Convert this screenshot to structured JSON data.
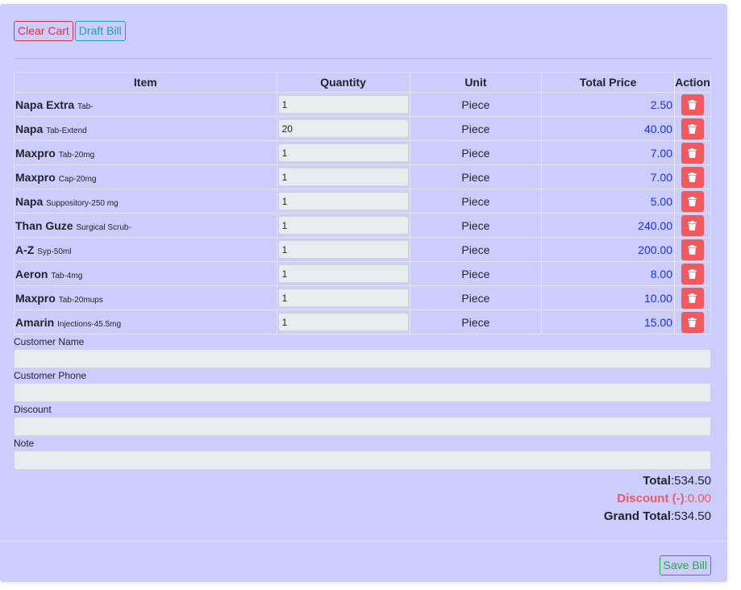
{
  "toolbar": {
    "clear_cart_label": "Clear Cart",
    "draft_bill_label": "Draft Bill"
  },
  "table": {
    "headers": [
      "Item",
      "Quantity",
      "Unit",
      "Total Price",
      "Action"
    ],
    "rows": [
      {
        "name": "Napa Extra",
        "detail": "Tab-",
        "quantity": "1",
        "unit": "Piece",
        "total_price": "2.50"
      },
      {
        "name": "Napa",
        "detail": "Tab-Extend",
        "quantity": "20",
        "unit": "Piece",
        "total_price": "40.00"
      },
      {
        "name": "Maxpro",
        "detail": "Tab-20mg",
        "quantity": "1",
        "unit": "Piece",
        "total_price": "7.00"
      },
      {
        "name": "Maxpro",
        "detail": "Cap-20mg",
        "quantity": "1",
        "unit": "Piece",
        "total_price": "7.00"
      },
      {
        "name": "Napa",
        "detail": "Suppository-250 mg",
        "quantity": "1",
        "unit": "Piece",
        "total_price": "5.00"
      },
      {
        "name": "Than Guze",
        "detail": "Surgical Scrub-",
        "quantity": "1",
        "unit": "Piece",
        "total_price": "240.00"
      },
      {
        "name": "A-Z",
        "detail": "Syp-50ml",
        "quantity": "1",
        "unit": "Piece",
        "total_price": "200.00"
      },
      {
        "name": "Aeron",
        "detail": "Tab-4mg",
        "quantity": "1",
        "unit": "Piece",
        "total_price": "8.00"
      },
      {
        "name": "Maxpro",
        "detail": "Tab-20mups",
        "quantity": "1",
        "unit": "Piece",
        "total_price": "10.00"
      },
      {
        "name": "Amarin",
        "detail": "Injections-45.5mg",
        "quantity": "1",
        "unit": "Piece",
        "total_price": "15.00"
      }
    ],
    "delete_icon": "trash-icon"
  },
  "form": {
    "customer_name_label": "Customer Name",
    "customer_name_value": "",
    "customer_phone_label": "Customer Phone",
    "customer_phone_value": "",
    "discount_label": "Discount",
    "discount_value": "",
    "note_label": "Note",
    "note_value": ""
  },
  "totals": {
    "total_label": "Total",
    "total_value": "534.50",
    "discount_label": "Discount (-)",
    "discount_value": "0.00",
    "grand_total_label": "Grand Total",
    "grand_total_value": "534.50"
  },
  "footer": {
    "save_bill_label": "Save Bill"
  },
  "colors": {
    "card_background": "#ccccff",
    "price_text": "#1a33e6",
    "delete_button": "#f05a5f",
    "danger": "#dc3545",
    "info": "#17a2b8",
    "success": "#28a745"
  }
}
